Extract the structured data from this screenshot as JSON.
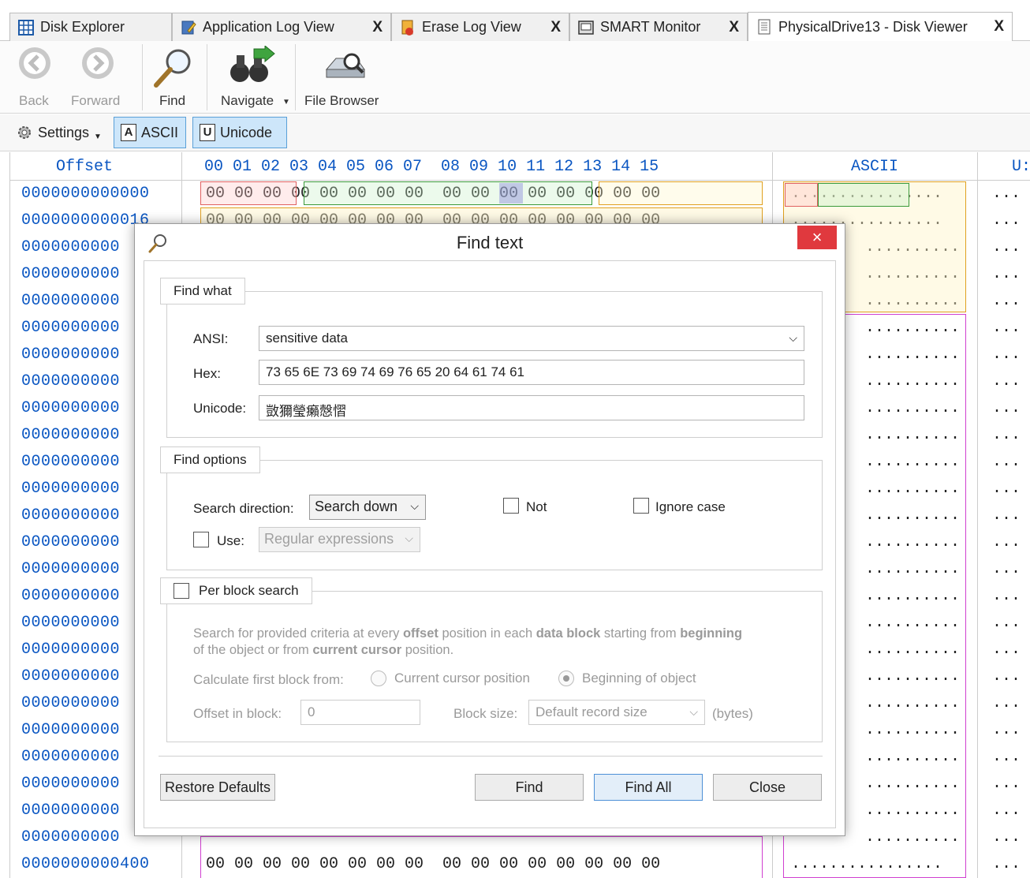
{
  "tabs": [
    {
      "label": "Disk Explorer",
      "closable": false,
      "active": false
    },
    {
      "label": "Application Log View",
      "closable": true,
      "active": false
    },
    {
      "label": "Erase Log View",
      "closable": true,
      "active": false
    },
    {
      "label": "SMART Monitor",
      "closable": true,
      "active": false
    },
    {
      "label": "PhysicalDrive13 - Disk Viewer",
      "closable": true,
      "active": true
    }
  ],
  "tab_close_glyph": "X",
  "toolbar": {
    "back": "Back",
    "forward": "Forward",
    "find": "Find",
    "navigate": "Navigate",
    "file_browser": "File Browser"
  },
  "toolbar2": {
    "settings": "Settings",
    "ascii": "ASCII",
    "ascii_key": "A",
    "unicode": "Unicode",
    "unicode_key": "U"
  },
  "hex": {
    "offset_header": "Offset",
    "column_header": "00 01 02 03 04 05 06 07  08 09 10 11 12 13 14 15",
    "ascii_header": "ASCII",
    "unicode_header": "U:",
    "rows": [
      {
        "offset": "0000000000000",
        "hex": "00 00 00 00 00 00 00 00  00 00 00 00 00 00 00 00",
        "ascii": "................",
        "uni": "..."
      },
      {
        "offset": "0000000000016",
        "hex": "00 00 00 00 00 00 00 00  00 00 00 00 00 00 00 00",
        "ascii": "................",
        "uni": "..."
      },
      {
        "offset": "0000000000",
        "hex": "",
        "ascii": "..........",
        "uni": "..."
      },
      {
        "offset": "0000000000",
        "hex": "",
        "ascii": "..........",
        "uni": "..."
      },
      {
        "offset": "0000000000",
        "hex": "",
        "ascii": "..........",
        "uni": "..."
      },
      {
        "offset": "0000000000",
        "hex": "",
        "ascii": "..........",
        "uni": "..."
      },
      {
        "offset": "0000000000",
        "hex": "",
        "ascii": "..........",
        "uni": "..."
      },
      {
        "offset": "0000000000",
        "hex": "",
        "ascii": "..........",
        "uni": "..."
      },
      {
        "offset": "0000000000",
        "hex": "",
        "ascii": "..........",
        "uni": "..."
      },
      {
        "offset": "0000000000",
        "hex": "",
        "ascii": "..........",
        "uni": "..."
      },
      {
        "offset": "0000000000",
        "hex": "",
        "ascii": "..........",
        "uni": "..."
      },
      {
        "offset": "0000000000",
        "hex": "",
        "ascii": "..........",
        "uni": "..."
      },
      {
        "offset": "0000000000",
        "hex": "",
        "ascii": "..........",
        "uni": "..."
      },
      {
        "offset": "0000000000",
        "hex": "",
        "ascii": "..........",
        "uni": "..."
      },
      {
        "offset": "0000000000",
        "hex": "",
        "ascii": "..........",
        "uni": "..."
      },
      {
        "offset": "0000000000",
        "hex": "",
        "ascii": "..........",
        "uni": "..."
      },
      {
        "offset": "0000000000",
        "hex": "",
        "ascii": "..........",
        "uni": "..."
      },
      {
        "offset": "0000000000",
        "hex": "",
        "ascii": "..........",
        "uni": "..."
      },
      {
        "offset": "0000000000",
        "hex": "",
        "ascii": "..........",
        "uni": "..."
      },
      {
        "offset": "0000000000",
        "hex": "",
        "ascii": "..........",
        "uni": "..."
      },
      {
        "offset": "0000000000",
        "hex": "",
        "ascii": "..........",
        "uni": "..."
      },
      {
        "offset": "0000000000",
        "hex": "",
        "ascii": "..........",
        "uni": "..."
      },
      {
        "offset": "0000000000",
        "hex": "",
        "ascii": "..........",
        "uni": "..."
      },
      {
        "offset": "0000000000",
        "hex": "",
        "ascii": "..........",
        "uni": "..."
      },
      {
        "offset": "0000000000",
        "hex": "",
        "ascii": "..........",
        "uni": "..."
      },
      {
        "offset": "0000000000400",
        "hex": "00 00 00 00 00 00 00 00  00 00 00 00 00 00 00 00",
        "ascii": "................",
        "uni": "..."
      }
    ]
  },
  "dialog": {
    "title": "Find text",
    "close_glyph": "×",
    "find_what": {
      "legend": "Find what",
      "ansi_label": "ANSI:",
      "ansi_value": "sensitive data",
      "hex_label": "Hex:",
      "hex_value": "73 65 6E 73 69 74 69 76 65 20 64 61 74 61",
      "unicode_label": "Unicode:",
      "unicode_value": "敳獮瑩癩⁥慤慴"
    },
    "find_options": {
      "legend": "Find options",
      "direction_label": "Search direction:",
      "direction_value": "Search down",
      "not_label": "Not",
      "ignore_case_label": "Ignore case",
      "use_label": "Use:",
      "use_value": "Regular expressions"
    },
    "per_block": {
      "legend": "Per block search",
      "desc_1a": "Search for provided criteria at every ",
      "desc_1b": "offset",
      "desc_1c": " position in each ",
      "desc_1d": "data block",
      "desc_1e": " starting from ",
      "desc_1f": "beginning",
      "desc_2a": "of the object or from ",
      "desc_2b": "current cursor",
      "desc_2c": " position.",
      "calc_label": "Calculate first block from:",
      "radio_cursor": "Current cursor position",
      "radio_beginning": "Beginning of object",
      "offset_label": "Offset in block:",
      "offset_value": "0",
      "block_size_label": "Block size:",
      "block_size_value": "Default record size",
      "bytes_label": "(bytes)"
    },
    "buttons": {
      "restore": "Restore Defaults",
      "find": "Find",
      "find_all": "Find All",
      "close": "Close"
    }
  }
}
